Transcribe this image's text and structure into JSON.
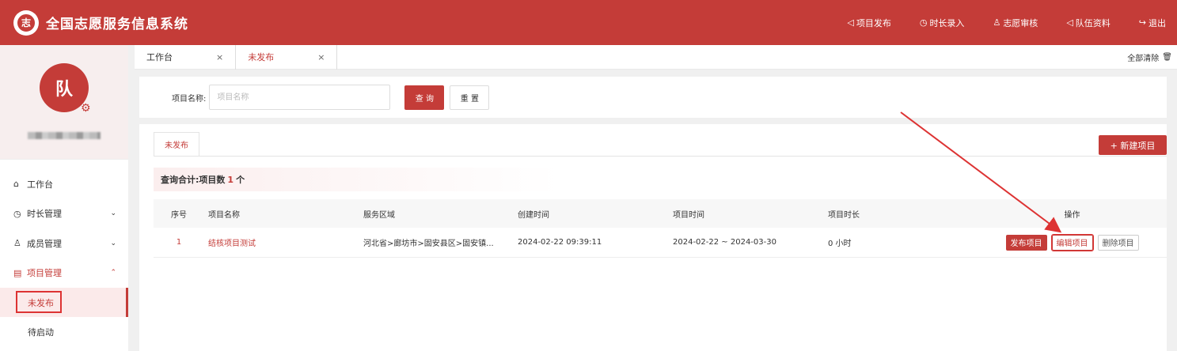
{
  "header": {
    "logo_glyph": "志",
    "title": "全国志愿服务信息系统",
    "nav": [
      {
        "icon": "send-icon",
        "glyph": "◁",
        "label": "项目发布"
      },
      {
        "icon": "clock-icon",
        "glyph": "◷",
        "label": "时长录入"
      },
      {
        "icon": "user-icon",
        "glyph": "♙",
        "label": "志愿审核"
      },
      {
        "icon": "send-icon",
        "glyph": "◁",
        "label": "队伍资料"
      },
      {
        "icon": "logout-icon",
        "glyph": "↪",
        "label": "退出"
      }
    ]
  },
  "sidebar": {
    "avatar_text": "队",
    "menu": [
      {
        "icon": "home-icon",
        "glyph": "⌂",
        "label": "工作台"
      },
      {
        "icon": "clock-icon",
        "glyph": "◷",
        "label": "时长管理",
        "chevron": "⌄"
      },
      {
        "icon": "user-icon",
        "glyph": "♙",
        "label": "成员管理",
        "chevron": "⌄"
      },
      {
        "icon": "document-icon",
        "glyph": "▤",
        "label": "项目管理",
        "chevron": "⌃"
      }
    ],
    "submenu": [
      {
        "label": "未发布"
      },
      {
        "label": "待启动"
      }
    ]
  },
  "tabs": {
    "items": [
      {
        "label": "工作台",
        "close": "×"
      },
      {
        "label": "未发布",
        "close": "×"
      }
    ],
    "clear_all": "全部清除"
  },
  "search": {
    "label": "项目名称:",
    "placeholder": "项目名称",
    "query_label": "查 询",
    "reset_label": "重 置"
  },
  "main": {
    "inner_tab": "未发布",
    "new_button": "+ 新建项目",
    "summary_prefix": "查询合计:项目数",
    "summary_count": "1",
    "summary_suffix": "个"
  },
  "table": {
    "headers": {
      "idx": "序号",
      "name": "项目名称",
      "area": "服务区域",
      "created": "创建时间",
      "ptime": "项目时间",
      "duration": "项目时长",
      "ops": "操作"
    },
    "rows": [
      {
        "idx": "1",
        "name": "结核项目测试",
        "area": "河北省>廊坊市>固安县区>固安镇...",
        "created": "2024-02-22 09:39:11",
        "ptime": "2024-02-22 ~ 2024-03-30",
        "duration": "0 小时",
        "ops": {
          "publish": "发布项目",
          "edit": "编辑项目",
          "delete": "删除项目"
        }
      }
    ]
  },
  "colors": {
    "brand": "#c43c38",
    "annotation": "#dd3333"
  }
}
